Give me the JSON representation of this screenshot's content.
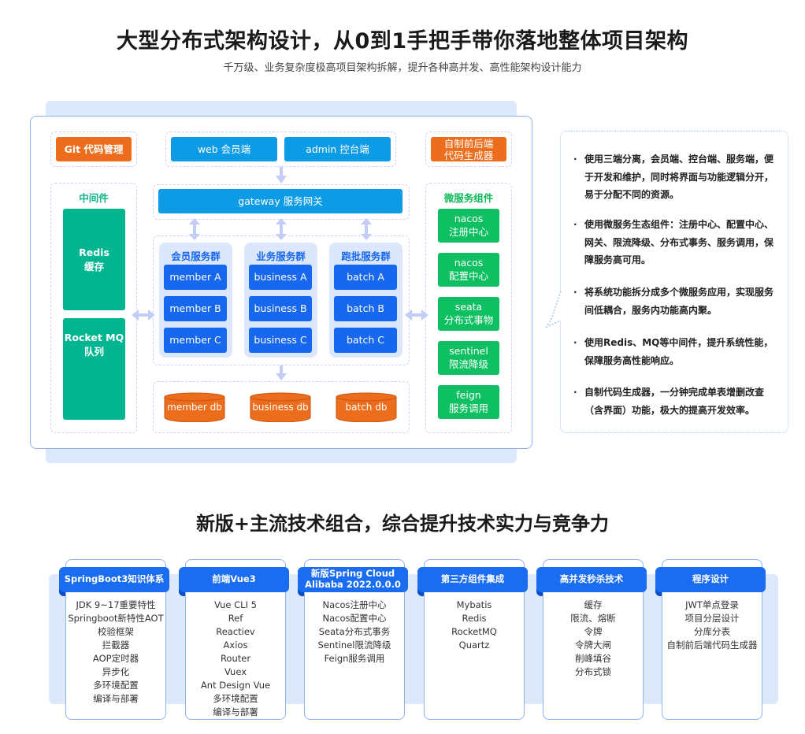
{
  "header": {
    "title": "大型分布式架构设计，从0到1手把手带你落地整体项目架构",
    "subtitle": "千万级、业务复杂度极高项目架构拆解，提升各种高并发、高性能架构设计能力"
  },
  "architecture": {
    "git": "Git 代码管理",
    "web_client": "web 会员端",
    "admin_client": "admin 控台端",
    "generator_line1": "自制前后端",
    "generator_line2": "代码生成器",
    "gateway": "gateway 服务网关",
    "middleware": {
      "title": "中间件",
      "items": [
        {
          "line1": "Redis",
          "line2": "缓存"
        },
        {
          "line1": "Rocket MQ",
          "line2": "队列"
        }
      ]
    },
    "service_groups": [
      {
        "title": "会员服务群",
        "items": [
          "member A",
          "member B",
          "member C"
        ]
      },
      {
        "title": "业务服务群",
        "items": [
          "business A",
          "business B",
          "business C"
        ]
      },
      {
        "title": "跑批服务群",
        "items": [
          "batch A",
          "batch B",
          "batch C"
        ]
      }
    ],
    "databases": [
      "member db",
      "business db",
      "batch db"
    ],
    "microservice": {
      "title": "微服务组件",
      "items": [
        {
          "line1": "nacos",
          "line2": "注册中心"
        },
        {
          "line1": "nacos",
          "line2": "配置中心"
        },
        {
          "line1": "seata",
          "line2": "分布式事物"
        },
        {
          "line1": "sentinel",
          "line2": "限流降级"
        },
        {
          "line1": "feign",
          "line2": "服务调用"
        }
      ]
    },
    "colors": {
      "orange": "#ec6d1c",
      "sky": "#0d9be6",
      "blue": "#1768ee",
      "teal": "#00b58f",
      "green": "#0ec061"
    }
  },
  "notes": {
    "bullet": "·",
    "items": [
      "使用三端分离，会员端、控台端、服务端，便于开发和维护，同时将界面与功能逻辑分开，易于分配不同的资源。",
      "使用微服务生态组件：注册中心、配置中心、网关、限流降级、分布式事务、服务调用，保障服务高可用。",
      "将系统功能拆分成多个微服务应用，实现服务间低耦合，服务内功能高内聚。",
      "使用Redis、MQ等中间件，提升系统性能，保障服务高性能响应。",
      "自制代码生成器，一分钟完成单表增删改查（含界面）功能，极大的提高开发效率。"
    ]
  },
  "tech": {
    "title": "新版+主流技术组合，综合提升技术实力与竞争力",
    "cards": [
      {
        "title": "SpringBoot3知识体系",
        "items": [
          "JDK 9~17重要特性",
          "Springboot新特性AOT",
          "校验框架",
          "拦截器",
          "AOP定时器",
          "异步化",
          "多环境配置",
          "编译与部署"
        ]
      },
      {
        "title": "前端Vue3",
        "items": [
          "Vue CLI 5",
          "Ref",
          "Reactiev",
          "Axios",
          "Router",
          "Vuex",
          "Ant Design Vue",
          "多环境配置",
          "编译与部署"
        ]
      },
      {
        "title": "新版Spring Cloud Alibaba 2022.0.0.0",
        "items": [
          "Nacos注册中心",
          "Nacos配置中心",
          "Seata分布式事务",
          "Sentinel限流降级",
          "Feign服务调用"
        ]
      },
      {
        "title": "第三方组件集成",
        "items": [
          "Mybatis",
          "Redis",
          "RocketMQ",
          "Quartz"
        ]
      },
      {
        "title": "高并发秒杀技术",
        "items": [
          "缓存",
          "限流、熔断",
          "令牌",
          "令牌大闸",
          "削峰填谷",
          "分布式锁"
        ]
      },
      {
        "title": "程序设计",
        "items": [
          "JWT单点登录",
          "项目分层设计",
          "分库分表",
          "自制前后端代码生成器"
        ]
      }
    ]
  }
}
